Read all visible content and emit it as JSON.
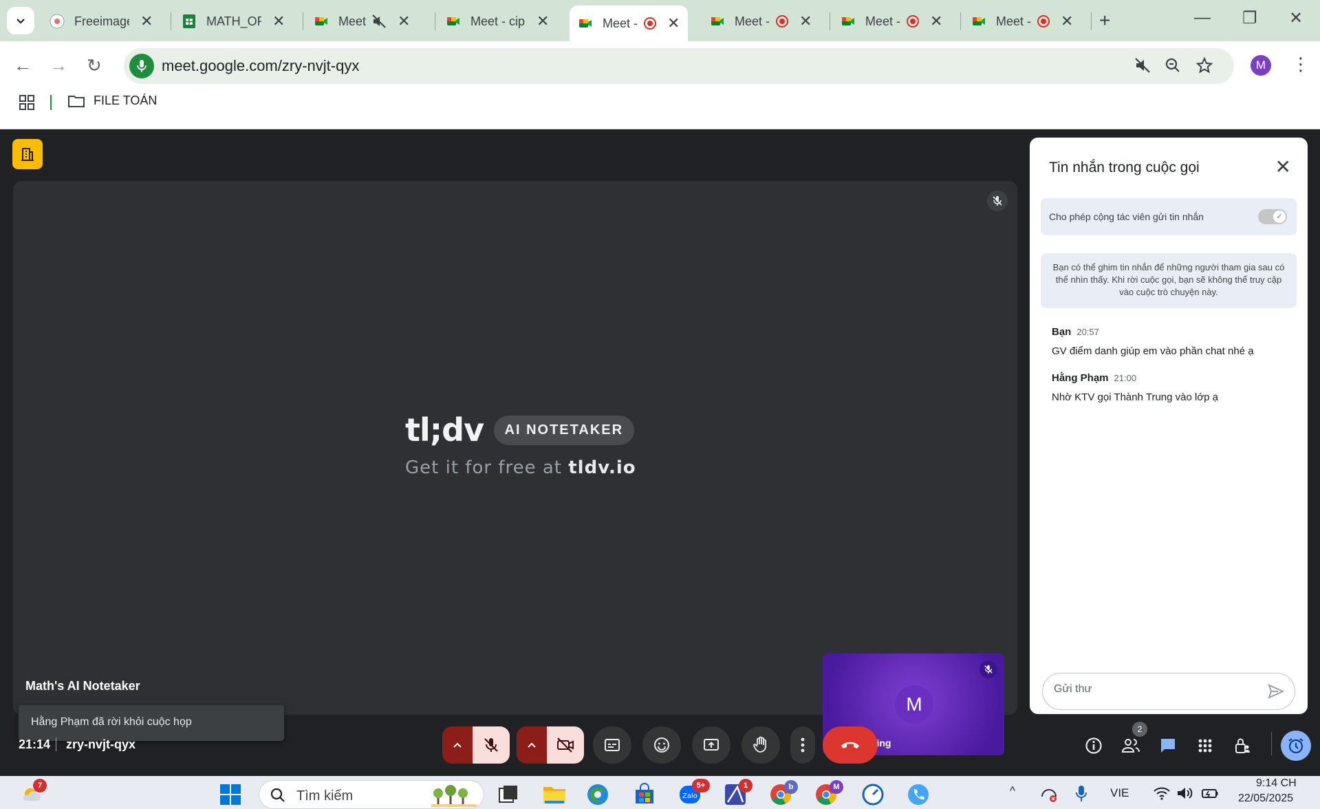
{
  "browser": {
    "tabs": [
      {
        "title": "Freeimage",
        "icon": "freeimage-icon"
      },
      {
        "title": "MATH_ORI",
        "icon": "sheets-icon"
      },
      {
        "title": "Meet -",
        "icon": "meet-icon",
        "muted": true
      },
      {
        "title": "Meet - cip",
        "icon": "meet-icon"
      },
      {
        "title": "Meet -",
        "icon": "meet-icon",
        "recording": true,
        "active": true
      },
      {
        "title": "Meet -",
        "icon": "meet-icon",
        "recording": true
      },
      {
        "title": "Meet -",
        "icon": "meet-icon",
        "recording": true
      },
      {
        "title": "Meet -",
        "icon": "meet-icon",
        "recording": true
      }
    ],
    "url": "meet.google.com/zry-nvjt-qyx",
    "profile_initial": "M",
    "bookmark": "FILE TOÁN"
  },
  "meet": {
    "stage": {
      "logo": "tl;dv",
      "logo_badge": "AI NOTETAKER",
      "promo_prefix": "Get it for free at ",
      "promo_domain": "tldv.io",
      "participant": "Math's AI Notetaker"
    },
    "toast": "Hằng Phạm đã rời khỏi cuộc họp",
    "self_tile": {
      "initial": "M",
      "name": "Math Meeting"
    },
    "chat": {
      "title": "Tin nhắn trong cuộc gọi",
      "allow_label": "Cho phép cộng tác viên gửi tin nhắn",
      "info": "Bạn có thể ghim tin nhắn để những người tham gia sau có thể nhìn thấy. Khi rời cuộc gọi, bạn sẽ không thể truy cập vào cuộc trò chuyện này.",
      "messages": [
        {
          "sender": "Bạn",
          "time": "20:57",
          "text": "GV điểm danh giúp em vào phần chat nhé ạ"
        },
        {
          "sender": "Hằng Phạm",
          "time": "21:00",
          "text": "Nhờ KTV gọi Thành Trung vào lớp ạ"
        }
      ],
      "input_placeholder": "Gửi thư"
    },
    "time": "21:14",
    "code": "zry-nvjt-qyx",
    "people_count": "2"
  },
  "taskbar": {
    "search_placeholder": "Tìm kiếm",
    "badges": {
      "weather": "7",
      "zalo": "5+",
      "app": "1",
      "chrome_b": "b",
      "chrome_m": "M"
    },
    "language": "VIE",
    "clock": "9:14 CH",
    "date": "22/05/2025"
  },
  "colors": {
    "accent": "#1a73e8",
    "end_call": "#dc362e",
    "tab_strip": "#d3e3d5",
    "host_badge": "#fbbc04"
  }
}
